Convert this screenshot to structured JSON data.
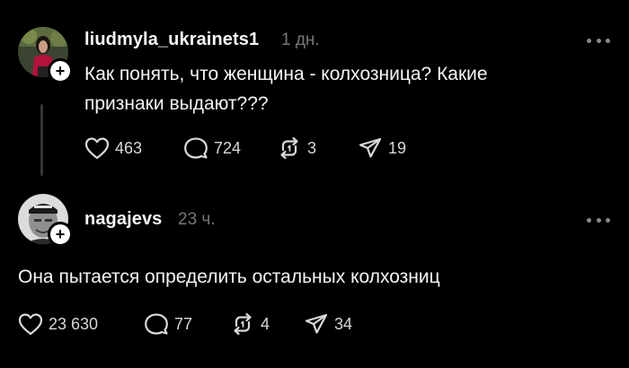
{
  "posts": [
    {
      "username": "liudmyla_ukrainets1",
      "time": "1 дн.",
      "text": "Как понять, что женщина - колхозница? Какие признаки выдают???",
      "likes": "463",
      "comments": "724",
      "reposts": "3",
      "shares": "19"
    },
    {
      "username": "nagajevs",
      "time": "23 ч.",
      "text": "Она пытается определить остальных колхозниц",
      "likes": "23 630",
      "comments": "77",
      "reposts": "4",
      "shares": "34"
    }
  ],
  "follow_symbol": "+",
  "colors": {
    "background": "#000000",
    "text": "#f3f5f7",
    "muted": "#777777",
    "icon": "#d8d8d8"
  },
  "icons": [
    "heart-icon",
    "comment-icon",
    "repost-icon",
    "share-icon",
    "more-icon",
    "plus-icon"
  ]
}
